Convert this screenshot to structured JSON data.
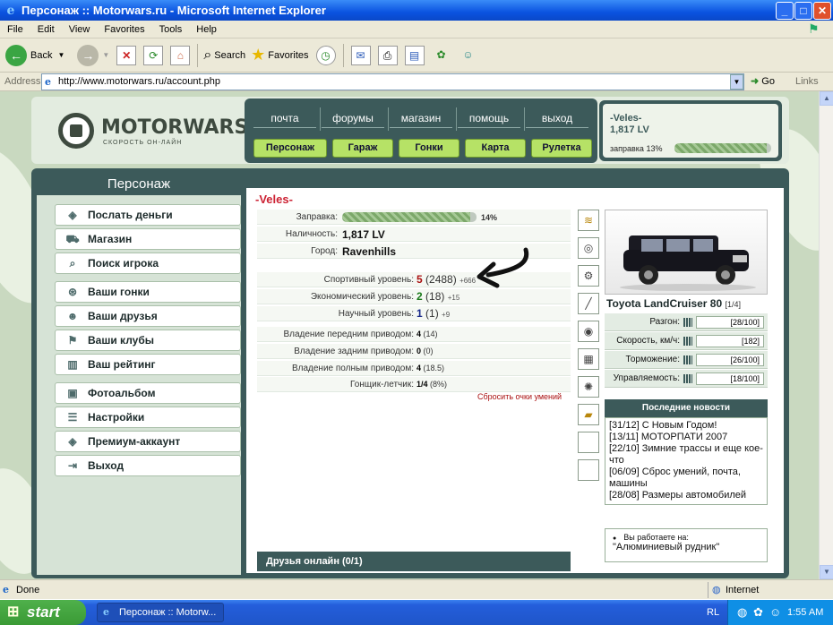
{
  "window": {
    "title": "Персонаж :: Motorwars.ru - Microsoft Internet Explorer",
    "min": "_",
    "max": "□",
    "close": "✕"
  },
  "menu": [
    "File",
    "Edit",
    "View",
    "Favorites",
    "Tools",
    "Help"
  ],
  "toolbar": {
    "back": "Back",
    "search": "Search",
    "favorites": "Favorites"
  },
  "address": {
    "label": "Address",
    "url": "http://www.motorwars.ru/account.php",
    "go": "Go",
    "links": "Links"
  },
  "site": {
    "logo": "MOTORWARS.RU",
    "tagline": "СКОРОСТЬ ОН-ЛАЙН",
    "top_links": [
      "почта",
      "форумы",
      "магазин",
      "помощь",
      "выход"
    ],
    "buttons": [
      "Персонаж",
      "Гараж",
      "Гонки",
      "Карта",
      "Рулетка"
    ],
    "user": {
      "nick": "-Veles-",
      "money": "1,817 LV",
      "fuel_label": "заправка 13%",
      "fuel_pct": 13
    }
  },
  "left": {
    "title": "Персонаж",
    "items": [
      {
        "label": "Послать деньги",
        "icon": "money-icon"
      },
      {
        "label": "Магазин",
        "icon": "shop-icon"
      },
      {
        "label": "Поиск игрока",
        "icon": "search-icon"
      },
      {
        "label": "Ваши гонки",
        "icon": "steering-wheel-icon"
      },
      {
        "label": "Ваши друзья",
        "icon": "friends-icon"
      },
      {
        "label": "Ваши клубы",
        "icon": "clubs-icon"
      },
      {
        "label": "Ваш рейтинг",
        "icon": "rating-icon"
      },
      {
        "label": "Фотоальбом",
        "icon": "photo-icon"
      },
      {
        "label": "Настройки",
        "icon": "settings-icon"
      },
      {
        "label": "Премиум-аккаунт",
        "icon": "premium-icon"
      },
      {
        "label": "Выход",
        "icon": "exit-icon"
      }
    ]
  },
  "profile": {
    "nick": "-Veles-",
    "fuel_label": "Заправка:",
    "fuel_pct_text": "14%",
    "fuel_pct": 14,
    "cash_label": "Наличность:",
    "cash": "1,817 LV",
    "city_label": "Город:",
    "city": "Ravenhills",
    "levels": [
      {
        "label": "Спортивный уровень:",
        "value": "5",
        "pts": "(2488)",
        "bonus": "+666",
        "color": "#a11"
      },
      {
        "label": "Экономический уровень:",
        "value": "2",
        "pts": "(18)",
        "bonus": "+15",
        "color": "#1a7a1a"
      },
      {
        "label": "Научный уровень:",
        "value": "1",
        "pts": "(1)",
        "bonus": "+9",
        "color": "#1a2a8a"
      }
    ],
    "drives": [
      {
        "label": "Владение передним приводом:",
        "value": "4",
        "pts": "(14)"
      },
      {
        "label": "Владение задним приводом:",
        "value": "0",
        "pts": "(0)"
      },
      {
        "label": "Владение полным приводом:",
        "value": "4",
        "pts": "(18.5)"
      }
    ],
    "racer_label": "Гонщик-летчик:",
    "racer": "1/4",
    "racer_pct": "(8%)",
    "reset": "Сбросить очки умений",
    "friends": "Друзья онлайн (0/1)"
  },
  "car": {
    "name": "Toyota LandCruiser 80",
    "slot": "[1/4]",
    "stats": [
      {
        "label": "Разгон:",
        "value": "[28/100]"
      },
      {
        "label": "Скорость, км/ч:",
        "value": "[182]"
      },
      {
        "label": "Торможение:",
        "value": "[26/100]"
      },
      {
        "label": "Управляемость:",
        "value": "[18/100]"
      }
    ]
  },
  "news": {
    "title": "Последние новости",
    "items": [
      "[31/12] С Новым Годом!",
      "[13/11] МОТОРПАТИ 2007",
      "[22/10] Зимние трассы и еще кое-что",
      "[06/09] Сброс умений, почта, машины",
      "[28/08] Размеры автомобилей"
    ]
  },
  "work": {
    "title": "Вы работаете на:",
    "job": "\"Алюминиевый рудник\""
  },
  "status": {
    "text": "Done",
    "zone": "Internet"
  },
  "taskbar": {
    "start": "start",
    "task": "Персонаж :: Motorw...",
    "lang": "RL",
    "time": "1:55 AM"
  }
}
